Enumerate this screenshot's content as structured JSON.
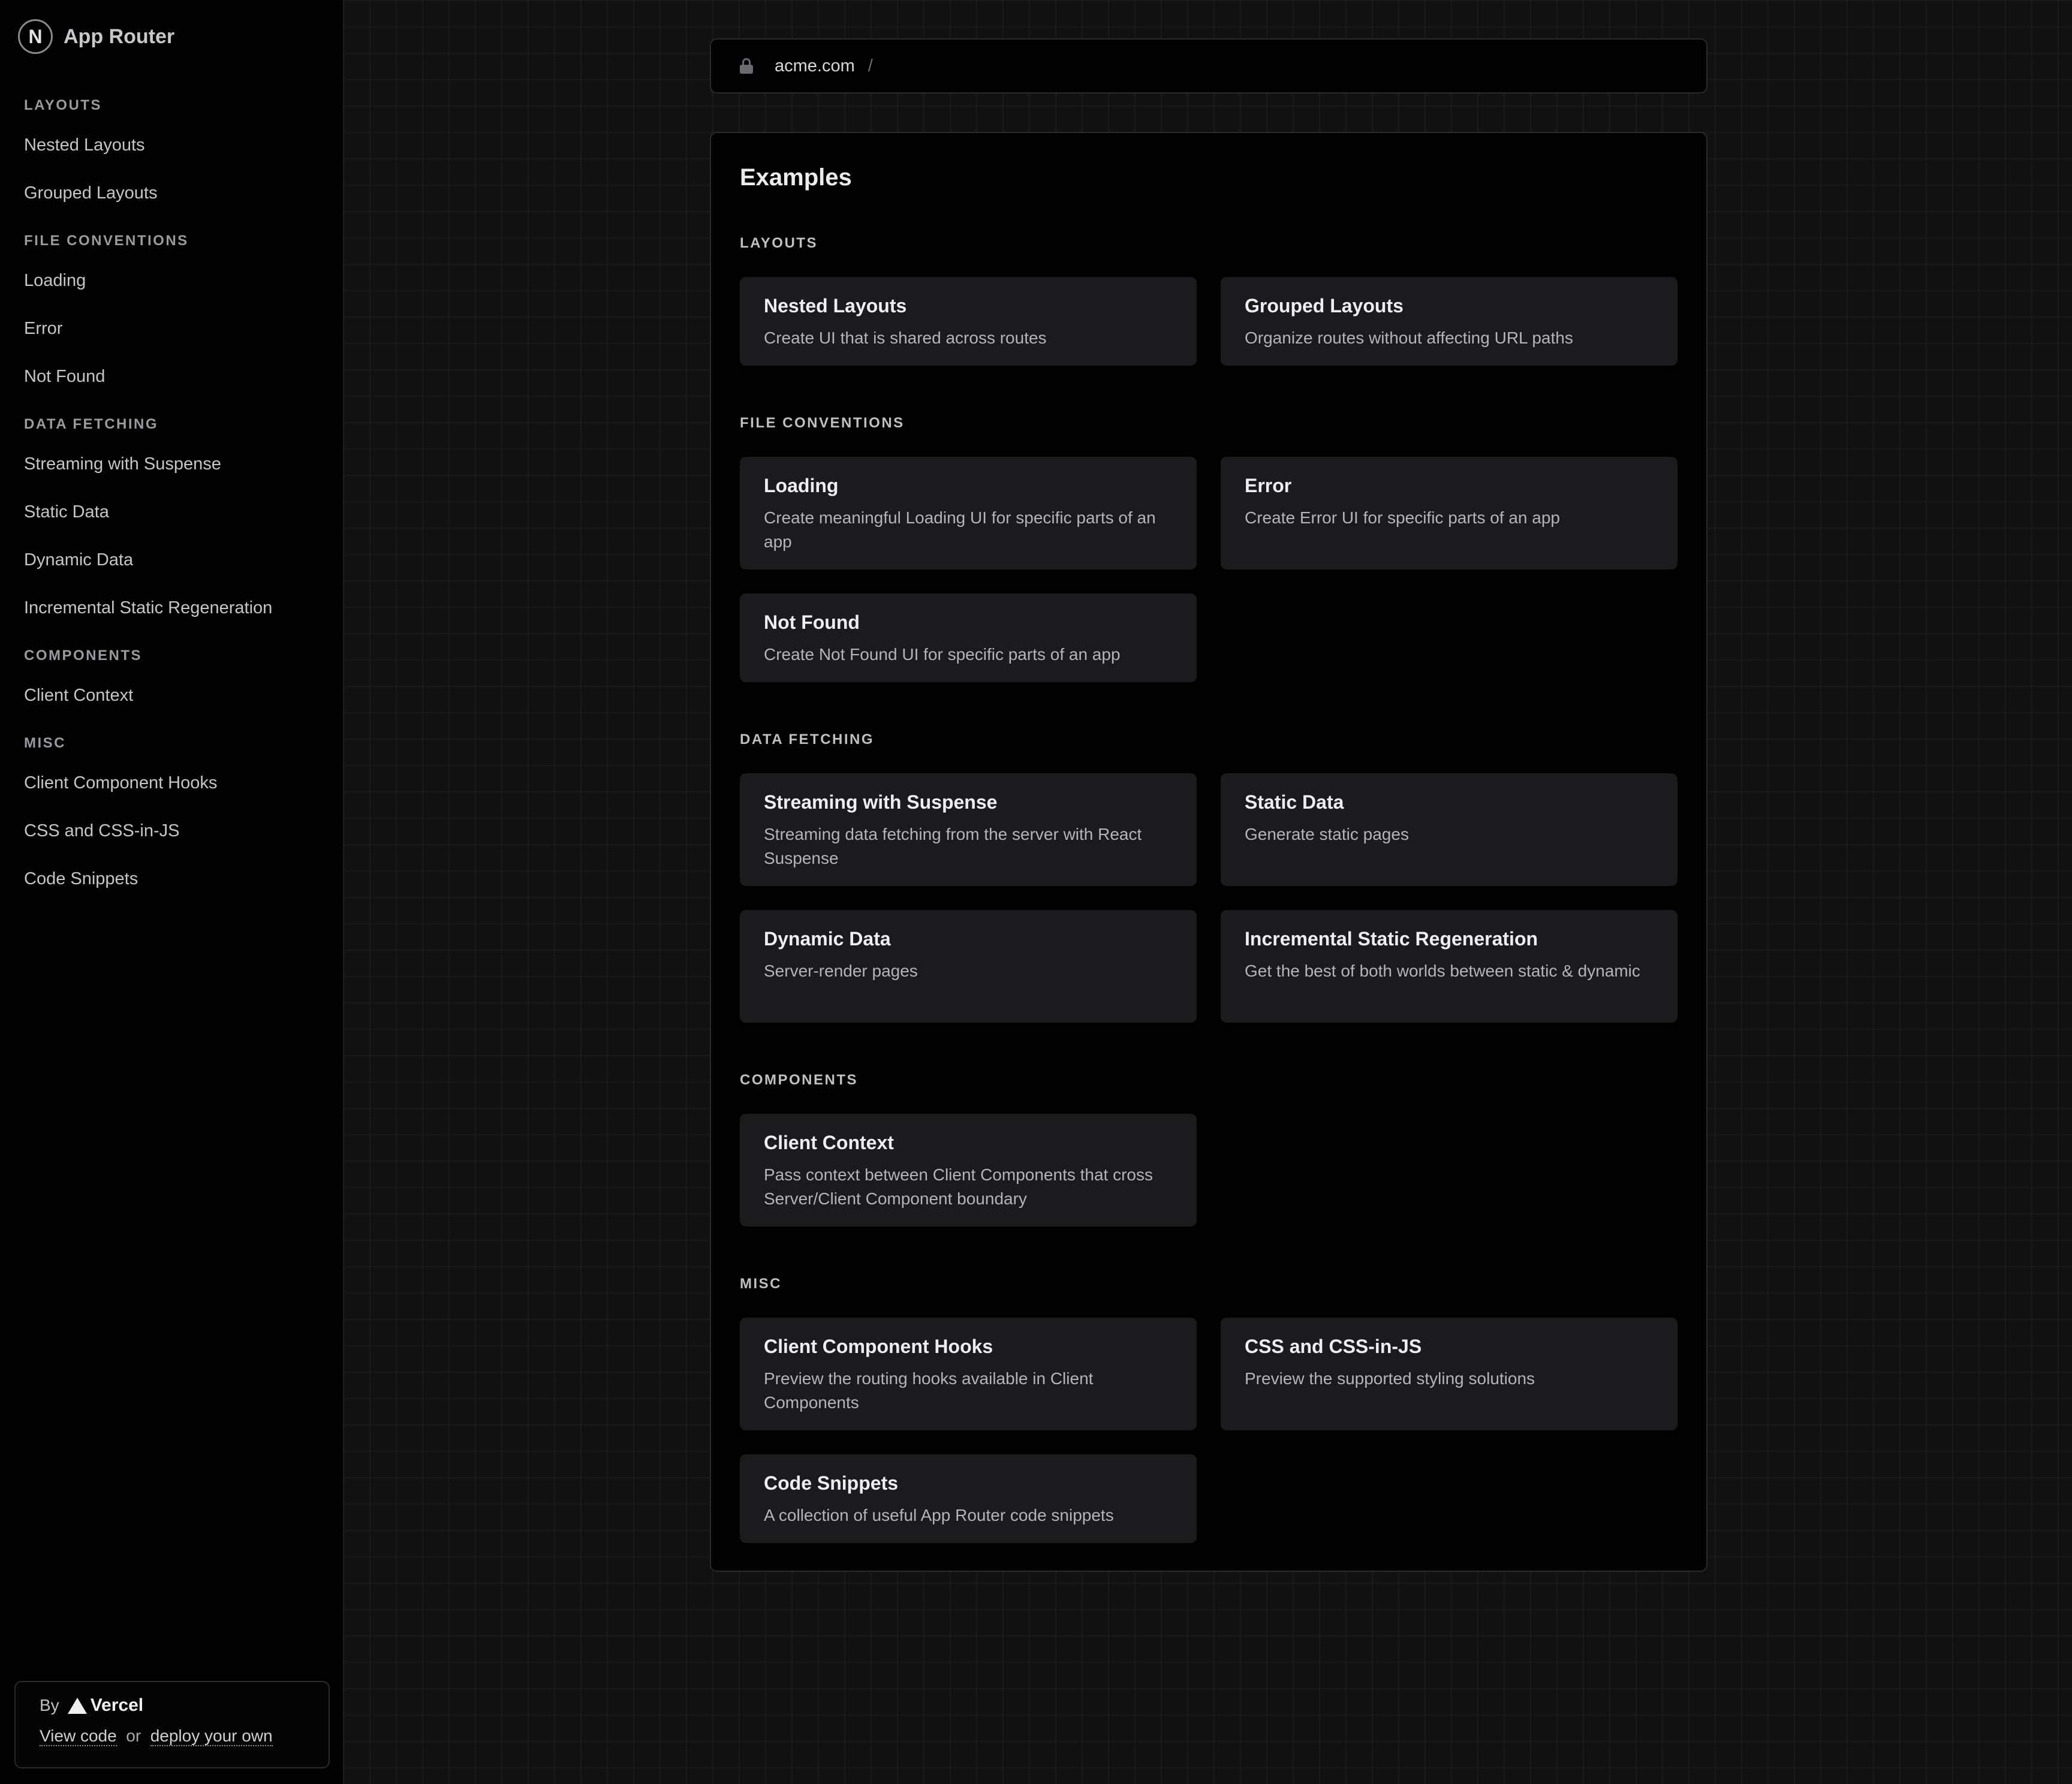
{
  "brand": {
    "logo_letter": "N",
    "title": "App Router"
  },
  "sidebar": {
    "groups": [
      {
        "heading": "LAYOUTS",
        "items": [
          "Nested Layouts",
          "Grouped Layouts"
        ]
      },
      {
        "heading": "FILE CONVENTIONS",
        "items": [
          "Loading",
          "Error",
          "Not Found"
        ]
      },
      {
        "heading": "DATA FETCHING",
        "items": [
          "Streaming with Suspense",
          "Static Data",
          "Dynamic Data",
          "Incremental Static Regeneration"
        ]
      },
      {
        "heading": "COMPONENTS",
        "items": [
          "Client Context"
        ]
      },
      {
        "heading": "MISC",
        "items": [
          "Client Component Hooks",
          "CSS and CSS-in-JS",
          "Code Snippets"
        ]
      }
    ]
  },
  "byline": {
    "by": "By",
    "company": "Vercel",
    "view_code": "View code",
    "or": "or",
    "deploy": "deploy your own"
  },
  "addressbar": {
    "domain": "acme.com",
    "separator": "/"
  },
  "main": {
    "title": "Examples",
    "sections": [
      {
        "heading": "LAYOUTS",
        "cards": [
          {
            "title": "Nested Layouts",
            "desc": "Create UI that is shared across routes"
          },
          {
            "title": "Grouped Layouts",
            "desc": "Organize routes without affecting URL paths"
          }
        ]
      },
      {
        "heading": "FILE CONVENTIONS",
        "cards": [
          {
            "title": "Loading",
            "desc": "Create meaningful Loading UI for specific parts of an app"
          },
          {
            "title": "Error",
            "desc": "Create Error UI for specific parts of an app"
          },
          {
            "title": "Not Found",
            "desc": "Create Not Found UI for specific parts of an app"
          }
        ]
      },
      {
        "heading": "DATA FETCHING",
        "cards": [
          {
            "title": "Streaming with Suspense",
            "desc": "Streaming data fetching from the server with React Suspense"
          },
          {
            "title": "Static Data",
            "desc": "Generate static pages"
          },
          {
            "title": "Dynamic Data",
            "desc": "Server-render pages"
          },
          {
            "title": "Incremental Static Regeneration",
            "desc": "Get the best of both worlds between static & dynamic"
          }
        ]
      },
      {
        "heading": "COMPONENTS",
        "cards": [
          {
            "title": "Client Context",
            "desc": "Pass context between Client Components that cross Server/Client Component boundary"
          }
        ]
      },
      {
        "heading": "MISC",
        "cards": [
          {
            "title": "Client Component Hooks",
            "desc": "Preview the routing hooks available in Client Components"
          },
          {
            "title": "CSS and CSS-in-JS",
            "desc": "Preview the supported styling solutions"
          },
          {
            "title": "Code Snippets",
            "desc": "A collection of useful App Router code snippets"
          }
        ]
      }
    ]
  }
}
